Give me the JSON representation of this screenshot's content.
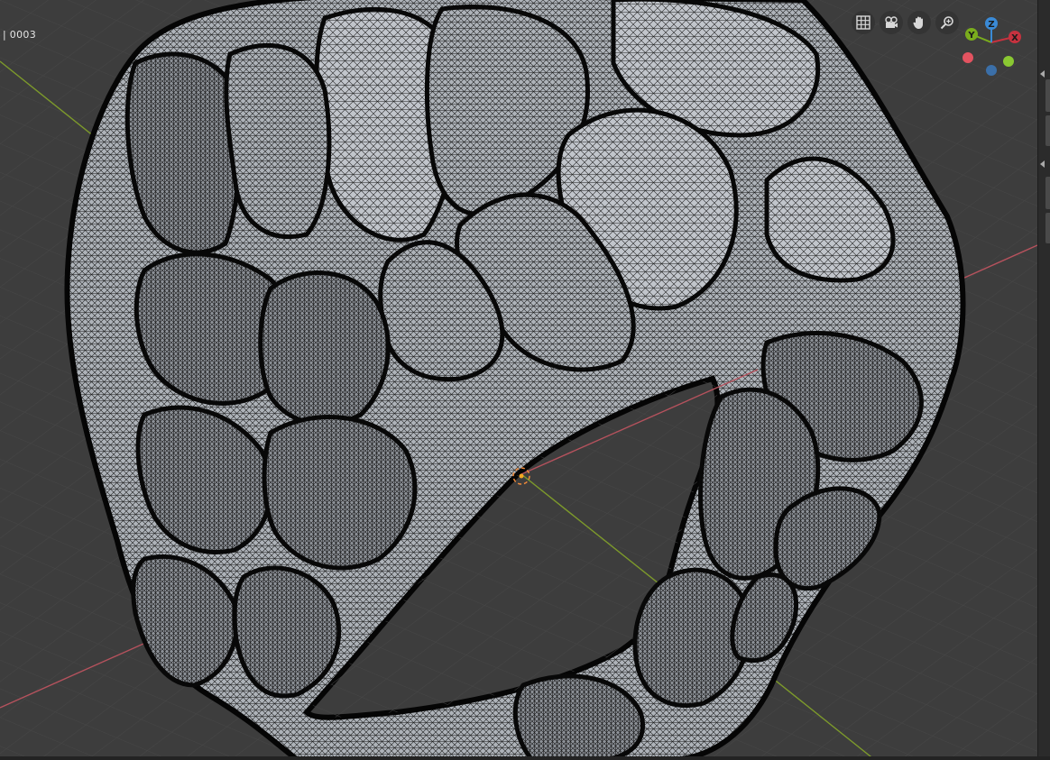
{
  "viewport": {
    "frame_label": "| 0003",
    "colors": {
      "background": "#3d3d3d",
      "grid": "#484848",
      "x_axis": "#b5525d",
      "y_axis": "#7d9a2b",
      "mesh_fill": "#a6abb1",
      "wire": "#101010",
      "origin": "#f08a3a"
    }
  },
  "nav_tools": [
    {
      "name": "toggle-grid-icon"
    },
    {
      "name": "camera-view-icon"
    },
    {
      "name": "pan-hand-icon"
    },
    {
      "name": "zoom-icon"
    }
  ],
  "gizmo": {
    "labels": {
      "x": "X",
      "y": "Y",
      "z": "Z"
    },
    "colors": {
      "x": "#c6323f",
      "y": "#7aad1d",
      "z": "#3a8ad6",
      "neg_x": "#e35360",
      "neg_y": "#8ac832",
      "neg_z": "#3b6fa8"
    }
  }
}
